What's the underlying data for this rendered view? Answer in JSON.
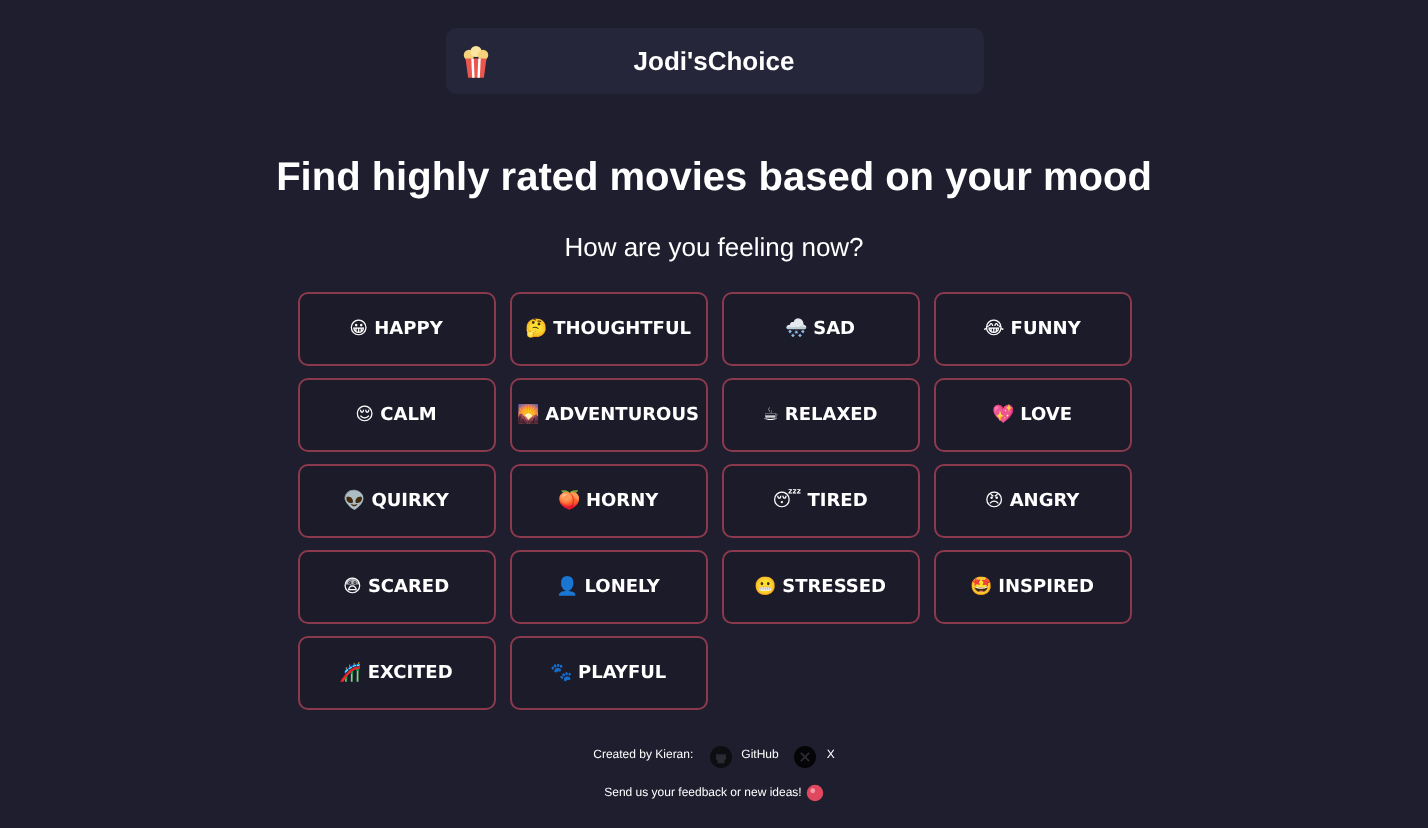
{
  "header": {
    "title": "Jodi'sChoice"
  },
  "heading": "Find highly rated movies based on your mood",
  "question": "How are you feeling now?",
  "moods": [
    {
      "emoji": "😀",
      "label": "HAPPY"
    },
    {
      "emoji": "🤔",
      "label": "THOUGHTFUL"
    },
    {
      "emoji": "🌨️",
      "label": "SAD"
    },
    {
      "emoji": "😂",
      "label": "FUNNY"
    },
    {
      "emoji": "😌",
      "label": "CALM"
    },
    {
      "emoji": "🌄",
      "label": "ADVENTUROUS"
    },
    {
      "emoji": "☕",
      "label": "RELAXED"
    },
    {
      "emoji": "💖",
      "label": "LOVE"
    },
    {
      "emoji": "👽",
      "label": "QUIRKY"
    },
    {
      "emoji": "🍑",
      "label": "HORNY"
    },
    {
      "emoji": "😴",
      "label": "TIRED"
    },
    {
      "emoji": "😠",
      "label": "ANGRY"
    },
    {
      "emoji": "😨",
      "label": "SCARED"
    },
    {
      "emoji": "👤",
      "label": "LONELY"
    },
    {
      "emoji": "😬",
      "label": "STRESSED"
    },
    {
      "emoji": "🤩",
      "label": "INSPIRED"
    },
    {
      "emoji": "🎢",
      "label": "EXCITED"
    },
    {
      "emoji": "🐾",
      "label": "PLAYFUL"
    }
  ],
  "footer": {
    "credit": "Created by Kieran:",
    "links": [
      {
        "kind": "github",
        "label": "GitHub"
      },
      {
        "kind": "x",
        "label": "X"
      }
    ],
    "feedback": "Send us your feedback or new ideas!"
  }
}
